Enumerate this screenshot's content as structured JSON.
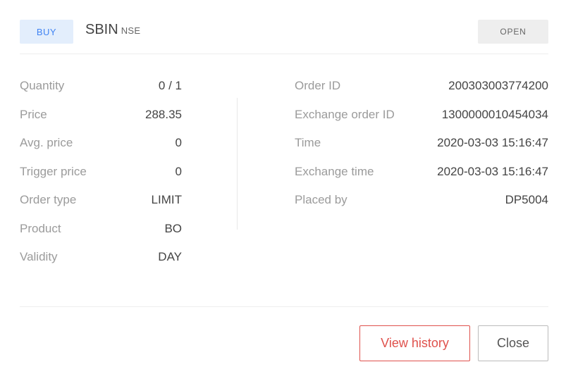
{
  "header": {
    "side_badge": "BUY",
    "symbol": "SBIN",
    "exchange": "NSE",
    "status_badge": "OPEN"
  },
  "left_details": [
    {
      "label": "Quantity",
      "value": "0 / 1"
    },
    {
      "label": "Price",
      "value": "288.35"
    },
    {
      "label": "Avg. price",
      "value": "0"
    },
    {
      "label": "Trigger price",
      "value": "0"
    },
    {
      "label": "Order type",
      "value": "LIMIT"
    },
    {
      "label": "Product",
      "value": "BO"
    },
    {
      "label": "Validity",
      "value": "DAY"
    }
  ],
  "right_details": [
    {
      "label": "Order ID",
      "value": "200303003774200"
    },
    {
      "label": "Exchange order ID",
      "value": "1300000010454034"
    },
    {
      "label": "Time",
      "value": "2020-03-03 15:16:47"
    },
    {
      "label": "Exchange time",
      "value": "2020-03-03 15:16:47"
    },
    {
      "label": "Placed by",
      "value": "DP5004"
    }
  ],
  "footer": {
    "history_label": "View history",
    "close_label": "Close"
  },
  "colors": {
    "buy_badge_bg": "#e3eefc",
    "buy_badge_text": "#4184f3",
    "status_badge_bg": "#eeeeee",
    "history_button": "#df514c"
  }
}
